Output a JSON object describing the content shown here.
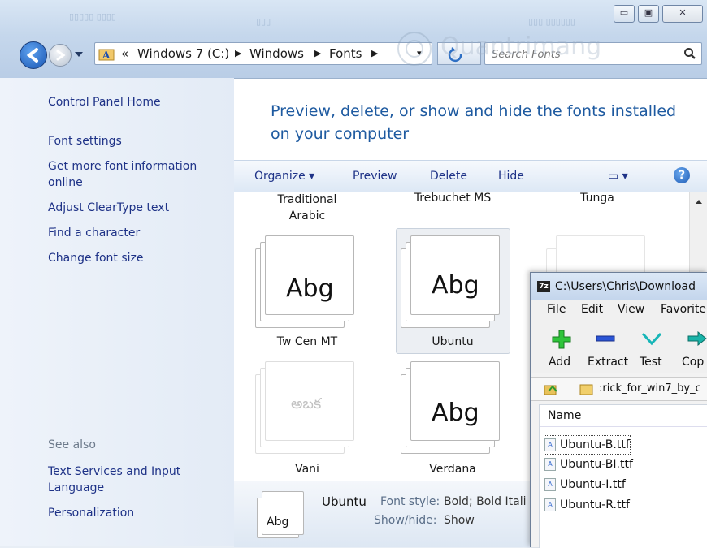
{
  "window": {
    "breadcrumb": [
      "«",
      "Windows 7 (C:)",
      "Windows",
      "Fonts"
    ],
    "search_placeholder": "Search Fonts",
    "controls": [
      "▭",
      "▣",
      "✕"
    ]
  },
  "left_pane": {
    "links": [
      "Control Panel Home",
      "Font settings",
      "Get more font information online",
      "Adjust ClearType text",
      "Find a character",
      "Change font size"
    ],
    "see_also_label": "See also",
    "see_also_links": [
      "Text Services and Input Language",
      "Personalization"
    ]
  },
  "heading": "Preview, delete, or show and hide the fonts installed on your computer",
  "toolbar": {
    "organize": "Organize ▾",
    "preview": "Preview",
    "delete": "Delete",
    "hide": "Hide",
    "view_icon": "▭ ▾",
    "help": "?"
  },
  "fonts": {
    "top_row": [
      "Traditional Arabic",
      "Trebuchet MS",
      "Tunga"
    ],
    "middle_row": [
      "Tw Cen MT",
      "Ubuntu"
    ],
    "bottom_row": [
      "Vani",
      "Verdana"
    ],
    "sample": "Abg",
    "vani_sample": "అబక"
  },
  "details": {
    "icon_text": "Abg",
    "name": "Ubuntu",
    "style_label": "Font style:",
    "style_value": "Bold; Bold Itali",
    "showhide_label": "Show/hide:",
    "showhide_value": "Show"
  },
  "sevenzip": {
    "title": "C:\\Users\\Chris\\Download",
    "menu": [
      "File",
      "Edit",
      "View",
      "Favorite"
    ],
    "buttons": [
      "Add",
      "Extract",
      "Test",
      "Cop"
    ],
    "path": ":rick_for_win7_by_c",
    "column": "Name",
    "files": [
      "Ubuntu-B.ttf",
      "Ubuntu-BI.ttf",
      "Ubuntu-I.ttf",
      "Ubuntu-R.ttf"
    ],
    "logo": "7z"
  },
  "watermark": "Quantrimang"
}
